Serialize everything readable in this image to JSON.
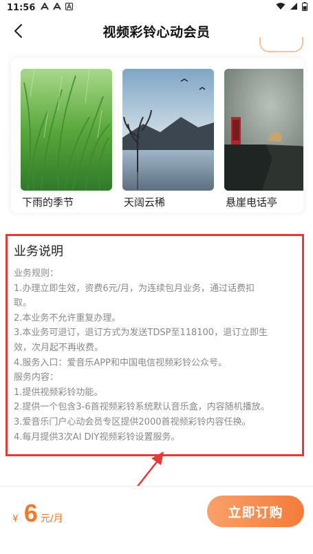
{
  "status_bar": {
    "time": "11:56",
    "notif_icons": [
      "a-notification-icon",
      "a-notification-icon",
      "a-boxed-notification-icon"
    ]
  },
  "header": {
    "title": "视频彩铃心动会员"
  },
  "ringtones": [
    {
      "name": "下雨的季节"
    },
    {
      "name": "天阔云稀"
    },
    {
      "name": "悬崖电话亭"
    }
  ],
  "description": {
    "title": "业务说明",
    "lines": [
      "业务规则：",
      "1.办理立即生效，资费6元/月，为连续包月业务，通过话费扣",
      "取。",
      "2.本业务不允许重复办理。",
      "3.本业务可退订，退订方式为发送TDSP至118100，退订立即生",
      "效，次月起不再收费。",
      "4.服务入口：爱音乐APP和中国电信视频彩铃公众号。",
      "服务内容：",
      "1.提供视频彩铃功能。",
      "2.提供一个包含3-6首视频彩铃系统默认音乐盒，内容随机播放。",
      "3.爱音乐门户心动会员专区提供2000首视频彩铃内容任换。",
      "4.每月提供3次AI DIY视频彩铃设置服务。"
    ]
  },
  "price": {
    "currency": "¥",
    "amount": "6",
    "unit": "元/月"
  },
  "subscribe_label": "立即订购",
  "colors": {
    "accent": "#f47b3a",
    "highlight_box": "#e53935"
  }
}
